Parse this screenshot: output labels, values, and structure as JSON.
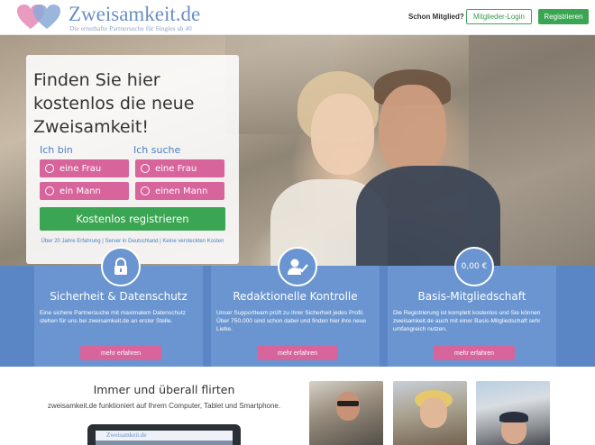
{
  "header": {
    "logo_title": "Zweisamkeit.de",
    "logo_subtitle": "Die ernsthafte Partnersuche für Singles ab 40",
    "member_question": "Schon Mitglied?",
    "login_label": "Mitglieder-Login",
    "register_label": "Registrieren"
  },
  "hero": {
    "title": "Finden Sie hier kostenlos die neue Zweisamkeit!",
    "i_am_label": "Ich bin",
    "i_seek_label": "Ich suche",
    "options": {
      "i_am_woman": "eine Frau",
      "i_am_man": "ein Mann",
      "seek_woman": "eine Frau",
      "seek_man": "einen Mann"
    },
    "register_button": "Kostenlos registrieren",
    "note": "Über 20 Jahre Erfahrung | Server in Deutschland | Keine versteckten Kosten"
  },
  "features": [
    {
      "icon": "lock-icon",
      "title": "Sicherheit & Datenschutz",
      "text": "Eine sichere Partnersuche mit maximalem Datenschutz stehen für uns bei zweisamkeit.de an erster Stelle.",
      "button": "mehr erfahren"
    },
    {
      "icon": "user-check-icon",
      "title": "Redaktionelle Kontrolle",
      "text": "Unser Supportteam prüft zu Ihrer Sicherheit jedes Profil. Über 750.000 sind schon dabei und finden hier ihre neue Liebe.",
      "button": "mehr erfahren"
    },
    {
      "icon": "money",
      "icon_text": "0,00 €",
      "title": "Basis-Mitgliedschaft",
      "text": "Die Registrierung ist komplett kostenlos und Sie können zweisamkeit.de auch mit einer Basis-Mitgliedschaft sehr umfangreich nutzen.",
      "button": "mehr erfahren"
    }
  ],
  "bottom": {
    "title": "Immer und überall flirten",
    "text": "zweisamkeit.de funktioniert auf Ihrem Computer, Tablet und Smartphone.",
    "laptop_logo": "Zweisamkeit.de"
  },
  "colors": {
    "brand_blue": "#6b8fc4",
    "green": "#3aa552",
    "pink": "#d8649c",
    "feature_blue": "#6a95d0"
  }
}
